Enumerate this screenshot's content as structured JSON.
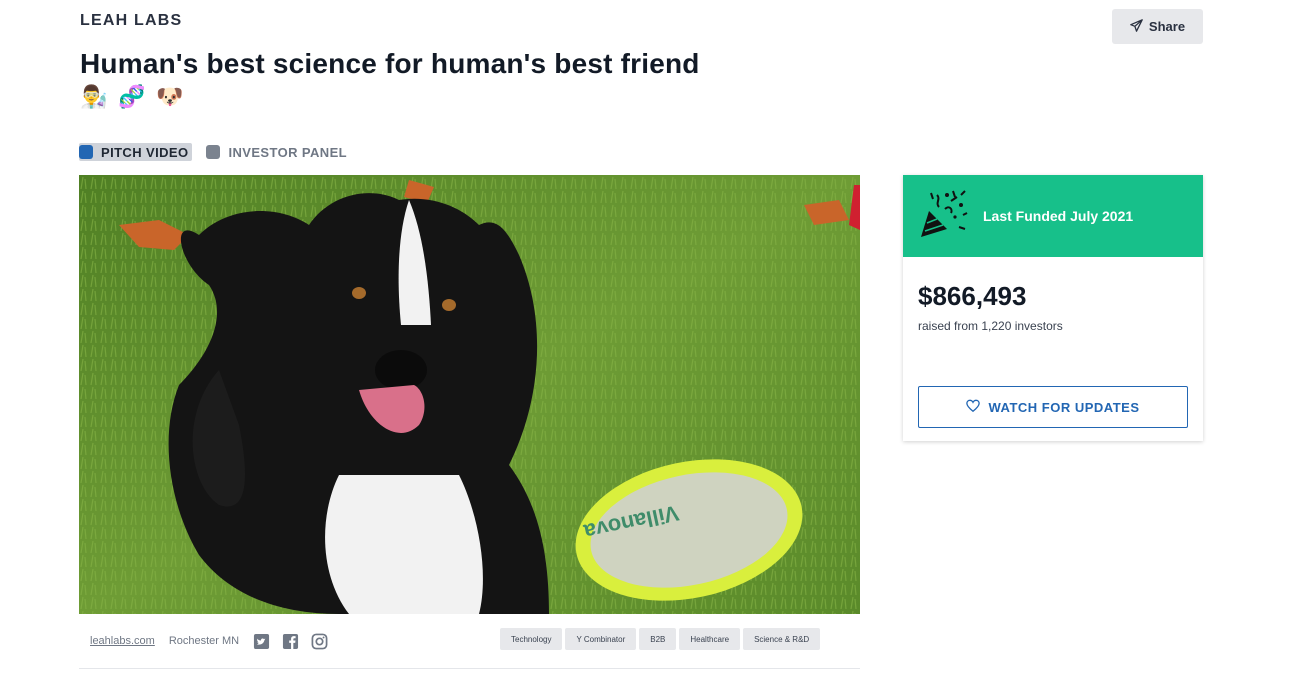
{
  "company": {
    "name": "LEAH LABS"
  },
  "share": {
    "label": "Share",
    "icon": "paper-plane-icon"
  },
  "headline": "Human's best science for human's best friend",
  "emojis": [
    {
      "icon": "scientist-emoji",
      "glyph": "👨‍🔬"
    },
    {
      "icon": "dna-emoji",
      "glyph": "🧬"
    },
    {
      "icon": "dog-face-emoji",
      "glyph": "🐶"
    }
  ],
  "tabs": [
    {
      "label": "PITCH VIDEO",
      "active": true
    },
    {
      "label": "INVESTOR PANEL",
      "active": false
    }
  ],
  "media": {
    "frisbee_text": "Villanova"
  },
  "meta": {
    "website": "leahlabs.com",
    "location": "Rochester MN",
    "social": [
      "twitter-icon",
      "facebook-icon",
      "instagram-icon"
    ]
  },
  "tags": [
    "Technology",
    "Y Combinator",
    "B2B",
    "Healthcare",
    "Science & R&D"
  ],
  "funding": {
    "banner": "Last Funded July 2021",
    "amount": "$866,493",
    "raised_text": "raised from 1,220 investors",
    "watch_label": "WATCH FOR UPDATES"
  },
  "colors": {
    "accent": "#2266b3",
    "banner": "#17c08a"
  }
}
